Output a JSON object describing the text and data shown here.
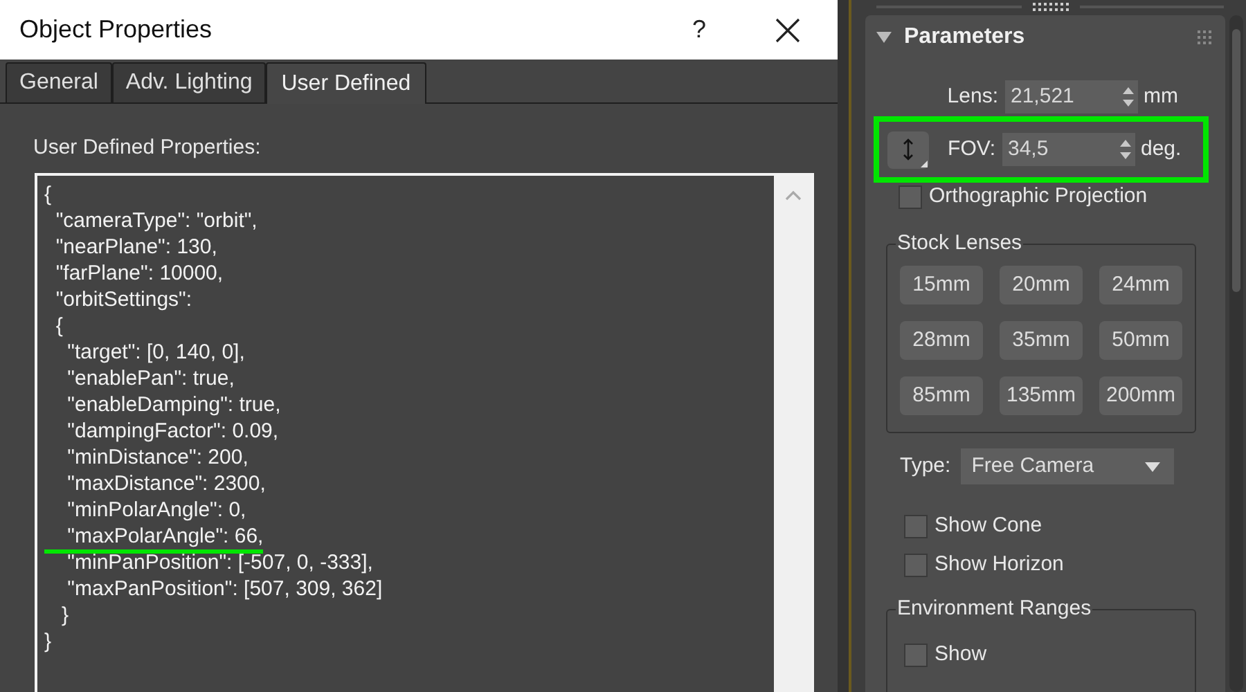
{
  "dialog": {
    "title": "Object Properties",
    "help_button": "?",
    "tabs": [
      {
        "label": "General",
        "selected": false
      },
      {
        "label": "Adv. Lighting",
        "selected": false
      },
      {
        "label": "User Defined",
        "selected": true
      }
    ],
    "properties_label": "User Defined Properties:",
    "code_lines": [
      {
        "text": "{",
        "highlighted": false
      },
      {
        "text": "  \"cameraType\": \"orbit\",",
        "highlighted": false
      },
      {
        "text": "  \"nearPlane\": 130,",
        "highlighted": false
      },
      {
        "text": "  \"farPlane\": 10000,",
        "highlighted": false
      },
      {
        "text": "  \"orbitSettings\":",
        "highlighted": false
      },
      {
        "text": "  {",
        "highlighted": false
      },
      {
        "text": "    \"target\": [0, 140, 0],",
        "highlighted": false
      },
      {
        "text": "    \"enablePan\": true,",
        "highlighted": false
      },
      {
        "text": "    \"enableDamping\": true,",
        "highlighted": false
      },
      {
        "text": "    \"dampingFactor\": 0.09,",
        "highlighted": false
      },
      {
        "text": "    \"minDistance\": 200,",
        "highlighted": false
      },
      {
        "text": "    \"maxDistance\": 2300,",
        "highlighted": false
      },
      {
        "text": "    \"minPolarAngle\": 0,",
        "highlighted": false
      },
      {
        "text": "    \"maxPolarAngle\": 66,",
        "highlighted": true
      },
      {
        "text": "    \"minPanPosition\": [-507, 0, -333],",
        "highlighted": false
      },
      {
        "text": "    \"maxPanPosition\": [507, 309, 362]",
        "highlighted": false
      },
      {
        "text": "   }",
        "highlighted": false
      },
      {
        "text": "}",
        "highlighted": false
      }
    ]
  },
  "parameters": {
    "title": "Parameters",
    "expanded": true,
    "lens": {
      "label": "Lens:",
      "value": "21,521",
      "unit": "mm"
    },
    "fov": {
      "label": "FOV:",
      "value": "34,5",
      "unit": "deg.",
      "highlighted": true
    },
    "orthographic": {
      "label": "Orthographic Projection",
      "checked": false
    },
    "stock_lenses": {
      "title": "Stock Lenses",
      "buttons": [
        "15mm",
        "20mm",
        "24mm",
        "28mm",
        "35mm",
        "50mm",
        "85mm",
        "135mm",
        "200mm"
      ]
    },
    "type": {
      "label": "Type:",
      "value": "Free Camera"
    },
    "checkboxes": [
      {
        "label": "Show Cone",
        "checked": false
      },
      {
        "label": "Show Horizon",
        "checked": false
      }
    ],
    "environment_ranges": {
      "title": "Environment Ranges",
      "show": {
        "label": "Show",
        "checked": false
      }
    }
  }
}
